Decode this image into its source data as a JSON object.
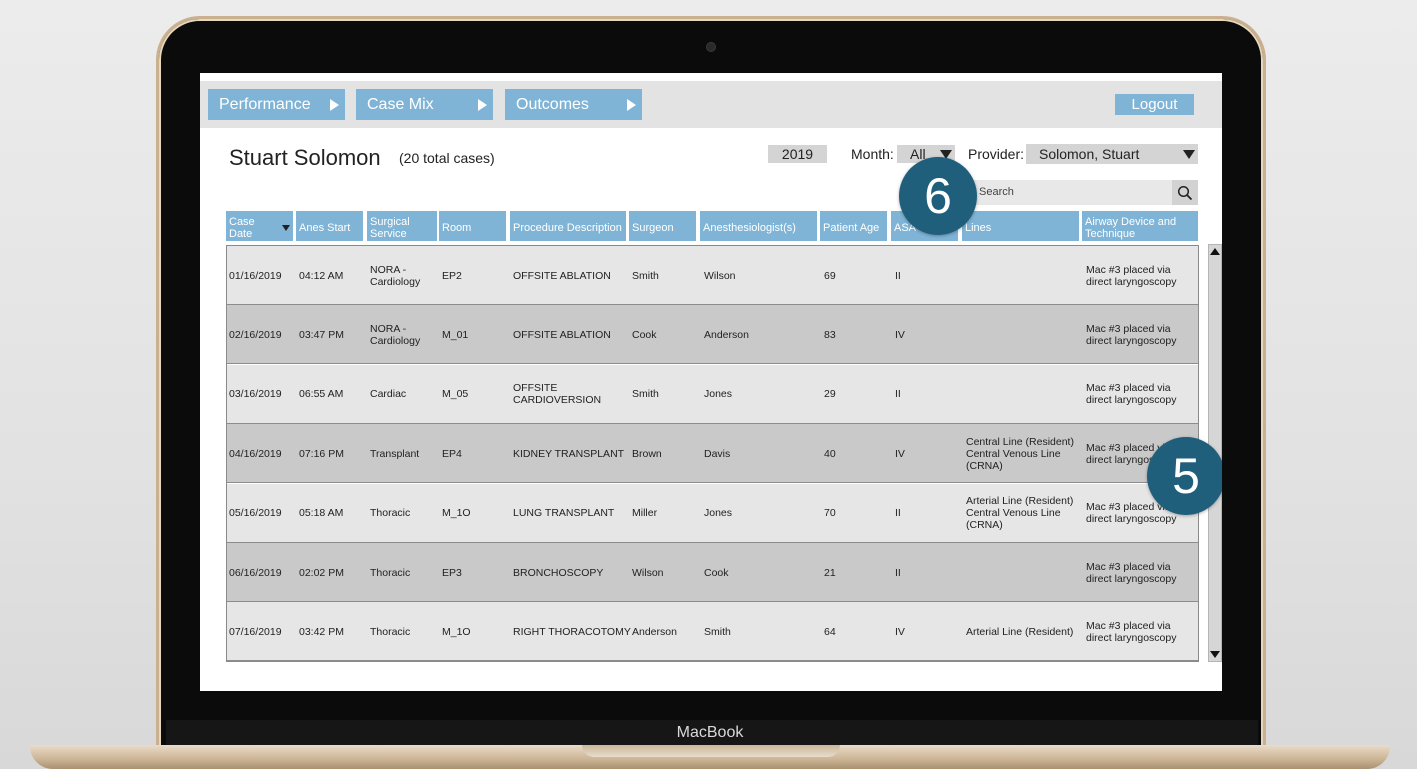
{
  "device": {
    "brand": "MacBook"
  },
  "nav": {
    "tabs": [
      {
        "label": "Performance"
      },
      {
        "label": "Case Mix"
      },
      {
        "label": "Outcomes"
      }
    ],
    "logout": "Logout"
  },
  "header": {
    "provider_name": "Stuart Solomon",
    "case_count": "(20 total cases)",
    "year": "2019",
    "month_label": "Month:",
    "month_value": "All",
    "provider_label": "Provider:",
    "provider_value": "Solomon, Stuart"
  },
  "search": {
    "placeholder": "Search"
  },
  "table": {
    "columns": [
      "Case Date",
      "Anes Start",
      "Surgical Service",
      "Room",
      "Procedure Description",
      "Surgeon",
      "Anesthesiologist(s)",
      "Patient Age",
      "ASA",
      "Lines",
      "Airway Device and Technique"
    ],
    "rows": [
      {
        "date": "01/16/2019",
        "start": "04:12 AM",
        "service": "NORA - Cardiology",
        "room": "EP2",
        "procedure": "OFFSITE ABLATION",
        "surgeon": "Smith",
        "anes": "Wilson",
        "age": "69",
        "asa": "II",
        "lines": "",
        "airway": "Mac #3 placed via direct laryngoscopy"
      },
      {
        "date": "02/16/2019",
        "start": "03:47 PM",
        "service": "NORA - Cardiology",
        "room": "M_01",
        "procedure": "OFFSITE ABLATION",
        "surgeon": "Cook",
        "anes": "Anderson",
        "age": "83",
        "asa": "IV",
        "lines": "",
        "airway": "Mac #3 placed via direct laryngoscopy"
      },
      {
        "date": "03/16/2019",
        "start": "06:55 AM",
        "service": "Cardiac",
        "room": "M_05",
        "procedure": "OFFSITE CARDIOVERSION",
        "surgeon": "Smith",
        "anes": "Jones",
        "age": "29",
        "asa": "II",
        "lines": "",
        "airway": "Mac #3 placed via direct laryngoscopy"
      },
      {
        "date": "04/16/2019",
        "start": "07:16 PM",
        "service": "Transplant",
        "room": "EP4",
        "procedure": "KIDNEY TRANSPLANT",
        "surgeon": "Brown",
        "anes": "Davis",
        "age": "40",
        "asa": "IV",
        "lines": "Central Line (Resident) Central Venous Line (CRNA)",
        "airway": "Mac #3 placed via direct laryngoscopy"
      },
      {
        "date": "05/16/2019",
        "start": "05:18 AM",
        "service": "Thoracic",
        "room": "M_1O",
        "procedure": "LUNG TRANSPLANT",
        "surgeon": "Miller",
        "anes": "Jones",
        "age": "70",
        "asa": "II",
        "lines": "Arterial Line (Resident) Central Venous Line (CRNA)",
        "airway": "Mac #3 placed via direct laryngoscopy"
      },
      {
        "date": "06/16/2019",
        "start": "02:02 PM",
        "service": "Thoracic",
        "room": "EP3",
        "procedure": "BRONCHOSCOPY",
        "surgeon": "Wilson",
        "anes": "Cook",
        "age": "21",
        "asa": "II",
        "lines": "",
        "airway": "Mac #3 placed via direct laryngoscopy"
      },
      {
        "date": "07/16/2019",
        "start": "03:42 PM",
        "service": "Thoracic",
        "room": "M_1O",
        "procedure": "RIGHT THORACOTOMY",
        "surgeon": "Anderson",
        "anes": "Smith",
        "age": "64",
        "asa": "IV",
        "lines": "Arterial Line (Resident)",
        "airway": "Mac #3 placed via direct laryngoscopy"
      }
    ]
  },
  "callouts": {
    "search_badge": "6",
    "table_badge": "5"
  },
  "colors": {
    "accent": "#7fb4d6",
    "badge": "#1f5f7c",
    "row_light": "#e6e6e6",
    "row_dark": "#c9c9c9"
  }
}
